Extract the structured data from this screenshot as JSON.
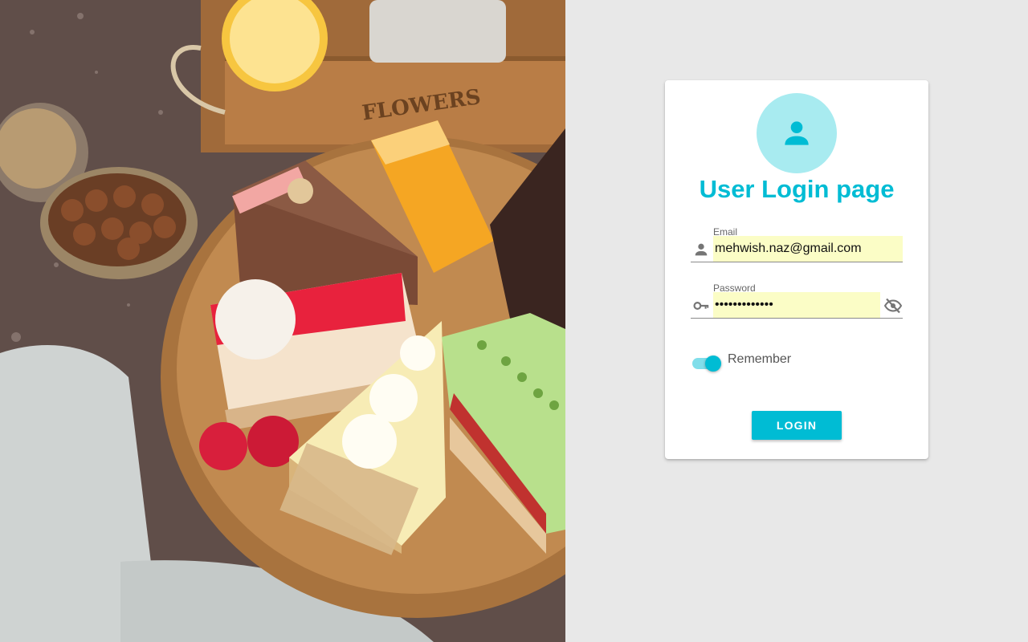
{
  "hero": {
    "image_subject": "assorted cake slices on a wooden board",
    "crate_text": "FLOWERS"
  },
  "card": {
    "avatar_icon": "user-icon",
    "title": "User Login page",
    "email": {
      "label": "Email",
      "value": "mehwish.naz@gmail.com",
      "icon": "person-icon"
    },
    "password": {
      "label": "Password",
      "value": "•••••••••••••",
      "icon": "key-icon",
      "toggle_icon": "visibility-off-icon"
    },
    "remember": {
      "label": "Remember",
      "checked": true
    },
    "login_label": "LOGIN"
  },
  "colors": {
    "accent": "#00bcd4",
    "avatar_bg": "#a8ebf0",
    "autofill_bg": "#fbfdc6",
    "page_bg": "#e8e8e8"
  }
}
